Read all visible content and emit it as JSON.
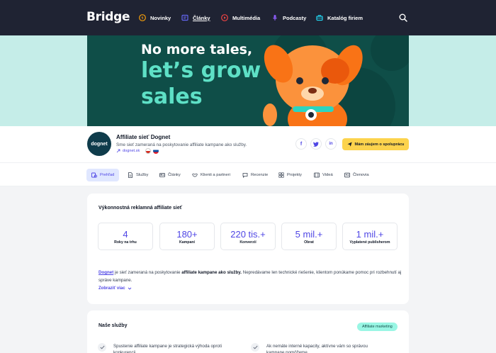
{
  "nav": {
    "logo": "Bridge",
    "items": [
      {
        "label": "Novinky",
        "icon": "bolt-icon",
        "color": "#f59e0b"
      },
      {
        "label": "Články",
        "icon": "article-icon",
        "color": "#6366f1"
      },
      {
        "label": "Multimédia",
        "icon": "play-icon",
        "color": "#ef4444"
      },
      {
        "label": "Podcasty",
        "icon": "microphone-icon",
        "color": "#8b5cf6"
      },
      {
        "label": "Katalóg firiem",
        "icon": "briefcase-icon",
        "color": "#22d3ee"
      }
    ]
  },
  "banner": {
    "line1": "No more tales,",
    "line2": "let’s grow",
    "line3": "sales"
  },
  "company": {
    "logo_text": "dognet",
    "name": "Affiliate sieť Dognet",
    "description": "Sme sieť zameraná na poskytovanie affiliate kampane ako služby.",
    "link": "dognet.sk",
    "cta": "Mám záujem o spoluprácu"
  },
  "tabs": [
    {
      "label": "Prehľad",
      "icon": "overview-icon"
    },
    {
      "label": "Služby",
      "icon": "document-icon"
    },
    {
      "label": "Články",
      "icon": "newspaper-icon"
    },
    {
      "label": "Klienti a partneri",
      "icon": "handshake-icon"
    },
    {
      "label": "Recenzie",
      "icon": "comment-icon"
    },
    {
      "label": "Projekty",
      "icon": "grid-icon"
    },
    {
      "label": "Videá",
      "icon": "film-icon"
    },
    {
      "label": "Členovia",
      "icon": "id-card-icon"
    }
  ],
  "overview": {
    "title": "Výkonnostná reklamná affiliate sieť",
    "stats": [
      {
        "value": "4",
        "label": "Roky na trhu"
      },
      {
        "value": "180+",
        "label": "Kampaní"
      },
      {
        "value": "220 tis.+",
        "label": "Konverzií"
      },
      {
        "value": "5 mil.+",
        "label": "Obrat"
      },
      {
        "value": "1 mil.+",
        "label": "Vyplatené publisherom"
      }
    ],
    "para_link": "Dognet",
    "para_1": " je sieť zameraná na poskytovanie ",
    "para_bold": "affiliate kampane ako služby.",
    "para_2": " Nepredávame len technické riešenie, klientom ponúkame pomoc pri rozbehnutí aj správe kampane.",
    "more": "Zobraziť viac"
  },
  "services": {
    "title": "Naše služby",
    "badge": "Affiliate marketing",
    "items": [
      "Spustenie affiliate kampane je strategická výhoda oproti konkurencii.",
      "Ak nemáte interné kapacity, aktívne vám so správou kampane pomôžeme."
    ]
  },
  "colors": {
    "nav_bg": "#1f2333",
    "accent": "#4f46e5",
    "banner_bg": "#0f4e48",
    "banner_text": "#5ee0c6",
    "cta": "#fcd34d"
  }
}
